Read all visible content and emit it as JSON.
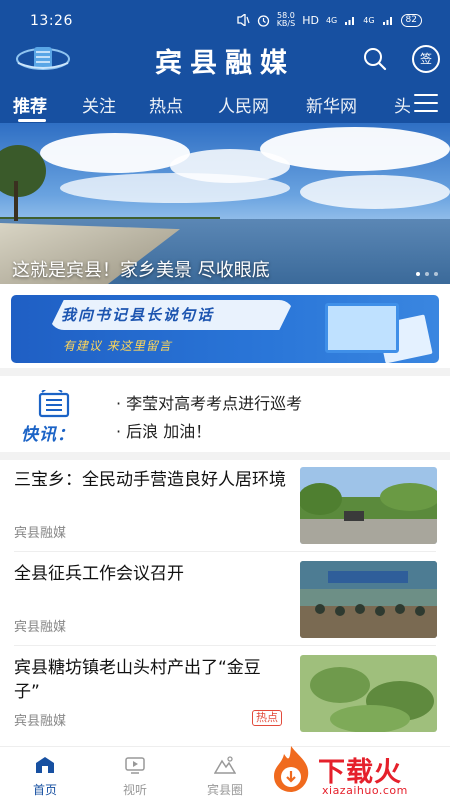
{
  "status_bar": {
    "time": "13:26",
    "speed_value": "58.0",
    "speed_unit": "KB/S",
    "hd": "HD",
    "signal1": "4G",
    "signal2": "4G",
    "battery": "82"
  },
  "header": {
    "title": "宾县融媒",
    "sign_label": "签"
  },
  "tabs": [
    "推荐",
    "关注",
    "热点",
    "人民网",
    "新华网",
    "头"
  ],
  "banner": {
    "caption": "这就是宾县！家乡美景 尽收眼底"
  },
  "promo": {
    "title": "我向书记县长说句话",
    "subtitle": "有建议 来这里留言"
  },
  "kuaixun": {
    "logo_text": "快讯：",
    "items": [
      "· 李莹对高考考点进行巡考",
      "· 后浪 加油！"
    ]
  },
  "news": [
    {
      "title": "三宝乡：全民动手营造良好人居环境",
      "source": "宾县融媒",
      "hot": ""
    },
    {
      "title": "全县征兵工作会议召开",
      "source": "宾县融媒",
      "hot": ""
    },
    {
      "title": "宾县糖坊镇老山头村产出了“金豆子”",
      "source": "宾县融媒",
      "hot": "热点"
    }
  ],
  "bottom_nav": {
    "items": [
      "首页",
      "视听",
      "宾县圈"
    ],
    "active": "首页"
  },
  "watermark": {
    "title": "下载火",
    "url": "xiazaihuo.com"
  },
  "colors": {
    "brand_blue": "#1750a1",
    "hot_red": "#e24a3b",
    "watermark_red": "#e5202b"
  }
}
